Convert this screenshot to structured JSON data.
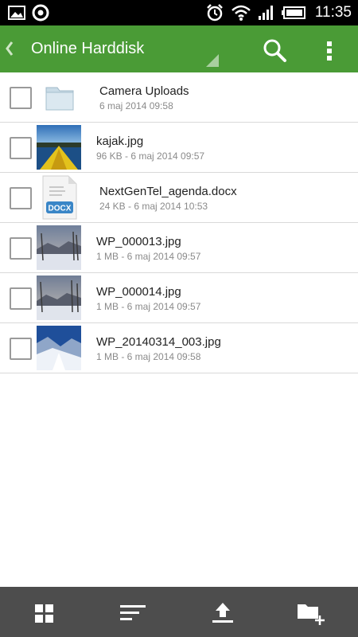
{
  "status_bar": {
    "time": "11:35",
    "icons": [
      "gallery-icon",
      "app-icon",
      "alarm-icon",
      "wifi-icon",
      "signal-icon",
      "battery-icon"
    ]
  },
  "app_bar": {
    "title": "Online Harddisk",
    "color": "#4a9b36",
    "icons": [
      "back-chevron-icon",
      "dropdown-triangle-icon",
      "search-icon",
      "overflow-menu-icon"
    ]
  },
  "files": [
    {
      "name": "Camera Uploads",
      "meta": "6 maj 2014 09:58",
      "kind": "folder"
    },
    {
      "name": "kajak.jpg",
      "meta": "96 KB - 6 maj 2014 09:57",
      "kind": "image-kayak"
    },
    {
      "name": "NextGenTel_agenda.docx",
      "meta": "24 KB - 6 maj 2014 10:53",
      "kind": "docx",
      "badge": "DOCX"
    },
    {
      "name": "WP_000013.jpg",
      "meta": "1 MB - 6 maj 2014 09:57",
      "kind": "image-winter"
    },
    {
      "name": "WP_000014.jpg",
      "meta": "1 MB - 6 maj 2014 09:57",
      "kind": "image-winter"
    },
    {
      "name": "WP_20140314_003.jpg",
      "meta": "1 MB - 6 maj 2014 09:58",
      "kind": "image-snow"
    }
  ],
  "bottom_bar": {
    "color": "#4d4d4d",
    "icons": [
      "grid-view-icon",
      "sort-icon",
      "upload-icon",
      "new-folder-icon"
    ]
  }
}
